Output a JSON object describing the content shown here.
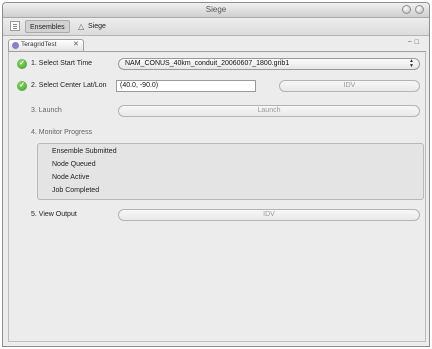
{
  "window": {
    "title": "Siege"
  },
  "toolbar": {
    "perspectives": [
      {
        "label": "Ensembles",
        "icon": "ensembles-icon",
        "active": true
      },
      {
        "label": "Siege",
        "icon": "siege-icon",
        "active": false
      }
    ]
  },
  "view": {
    "tab_label": "TeragridTest",
    "tab_close": "✕",
    "minimize": "−",
    "maximize": "□"
  },
  "steps": {
    "start_time": {
      "label": "1. Select Start Time",
      "completed": true,
      "value": "NAM_CONUS_40km_conduit_20060607_1800.grib1"
    },
    "center": {
      "label": "2. Select Center Lat/Lon",
      "completed": true,
      "value": "(40.0, -90.0)",
      "button": "IDV"
    },
    "launch": {
      "label": "3. Launch",
      "button": "Launch"
    },
    "monitor": {
      "label": "4. Monitor Progress",
      "items": [
        "Ensemble Submitted",
        "Node Queued",
        "Node Active",
        "Job Completed"
      ]
    },
    "view_output": {
      "label": "5. View Output",
      "button": "IDV"
    }
  },
  "colors": {
    "check_green": "#3a9b26",
    "tab_icon": "#8a7fc7"
  }
}
